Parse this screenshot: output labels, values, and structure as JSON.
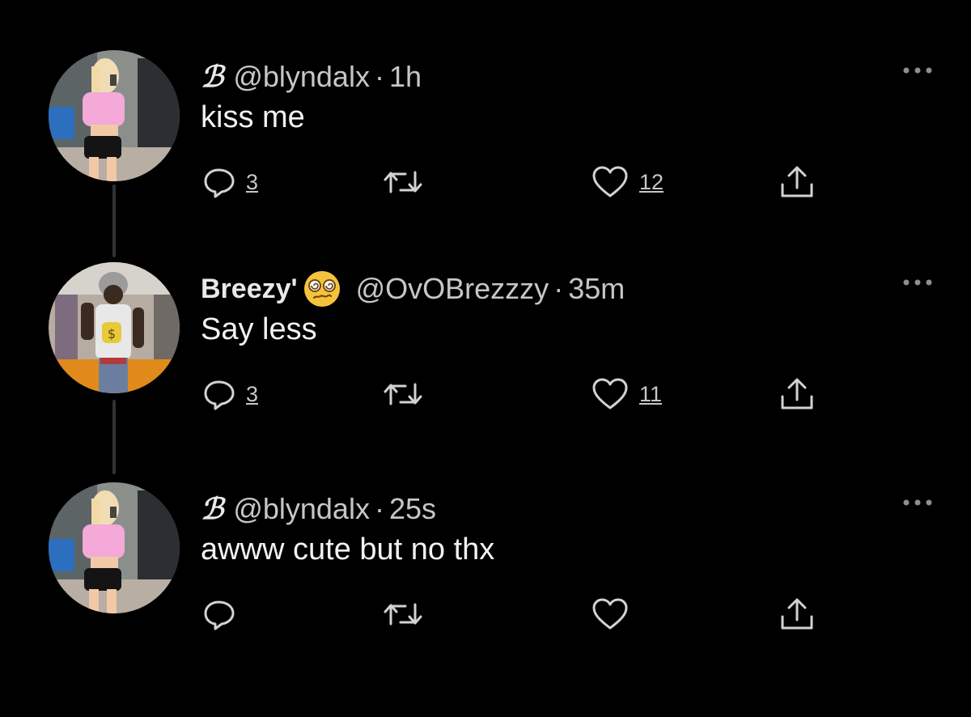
{
  "tweets": [
    {
      "display_name": "ℬ",
      "handle": "@blyndalx",
      "separator": "·",
      "time": "1h",
      "text": "kiss me",
      "reply_count": "3",
      "retweet_count": "",
      "like_count": "12",
      "avatar": "avatar-girl-pink-top"
    },
    {
      "display_name": "Breezy'",
      "emoji": "dizzy-face-emoji",
      "handle": "@OvOBrezzzy",
      "separator": "·",
      "time": "35m",
      "text": "Say less",
      "reply_count": "3",
      "retweet_count": "",
      "like_count": "11",
      "avatar": "avatar-man-subway"
    },
    {
      "display_name": "ℬ",
      "handle": "@blyndalx",
      "separator": "·",
      "time": "25s",
      "text": "awww cute but no thx",
      "reply_count": "",
      "retweet_count": "",
      "like_count": "",
      "avatar": "avatar-girl-pink-top"
    }
  ],
  "colors": {
    "background": "#000000",
    "text": "#e7e9ea",
    "muted": "#c4c7ca",
    "connector": "#2f3336"
  }
}
